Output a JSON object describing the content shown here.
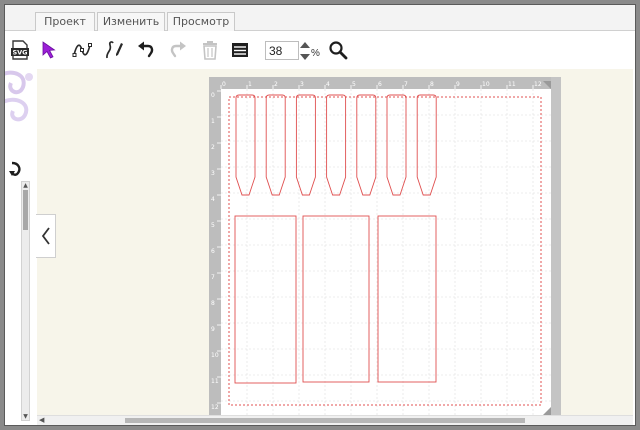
{
  "tabs": [
    {
      "label": "Проект"
    },
    {
      "label": "Изменить"
    },
    {
      "label": "Просмотр"
    }
  ],
  "toolbar": {
    "tools": [
      "svg-import-icon",
      "select-arrow-icon",
      "node-edit-icon",
      "pen-icon",
      "undo-icon",
      "redo-icon",
      "trash-icon",
      "layers-icon"
    ],
    "zoom_value": "38",
    "zoom_unit": "%",
    "search_icon": "magnifier-icon"
  },
  "colors": {
    "accent": "#9b1fd6",
    "cut_line": "#e05050",
    "mat": "#c8c8c8",
    "workspace": "#f7f5ea"
  },
  "ruler": {
    "top": [
      "0",
      "1",
      "2",
      "3",
      "4",
      "5",
      "6",
      "7",
      "8",
      "9",
      "10",
      "11",
      "12"
    ],
    "left": [
      "0",
      "1",
      "2",
      "3",
      "4",
      "5",
      "6",
      "7",
      "8",
      "9",
      "10",
      "11",
      "12"
    ]
  },
  "cut_shapes": {
    "pointed_stakes": 7,
    "rectangles": 3
  }
}
